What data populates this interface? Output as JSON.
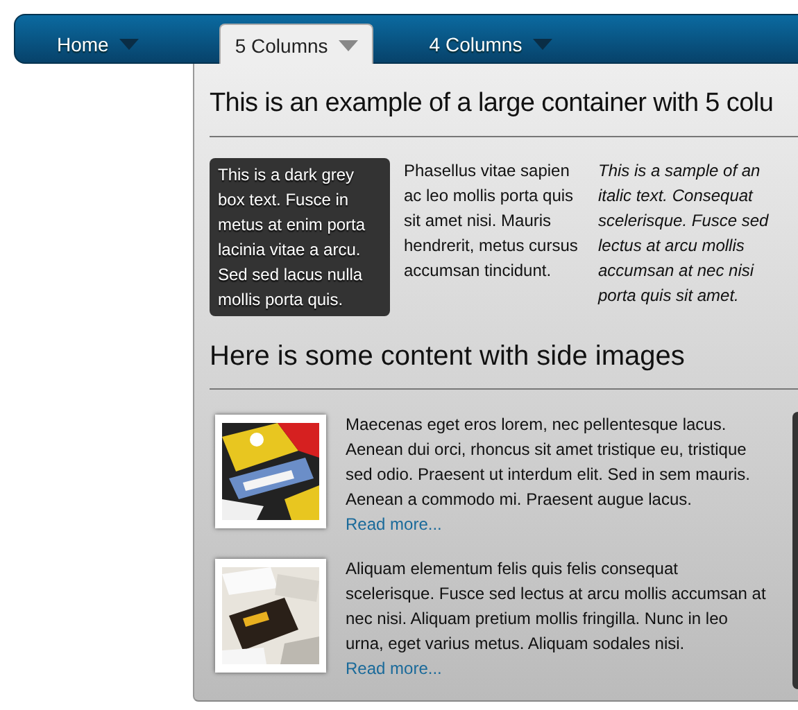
{
  "nav": {
    "items": [
      {
        "label": "Home",
        "selected": false
      },
      {
        "label": "5 Columns",
        "selected": true
      },
      {
        "label": "4 Columns",
        "selected": false
      }
    ]
  },
  "panel": {
    "heading": "This is an example of a large container with 5 colu",
    "columns": [
      {
        "kind": "dark",
        "text": "This is a dark grey box text. Fusce in metus at enim porta lacinia vitae a arcu. Sed sed lacus nulla mollis porta quis."
      },
      {
        "kind": "plain",
        "text": "Phasellus vitae sapien ac leo mollis porta quis sit amet nisi. Mauris hendrerit, metus cursus accumsan tincidunt."
      },
      {
        "kind": "italic",
        "text": "This is a sample of an italic text. Consequat scelerisque. Fusce sed lectus at arcu mollis accumsan at nec nisi porta quis sit amet."
      }
    ],
    "section_heading": "Here is some content with side images",
    "articles": [
      {
        "text": "Maecenas eget eros lorem, nec pellentesque lacus. Aenean dui orci, rhoncus sit amet tristique eu, tristique sed odio. Praesent ut interdum elit. Sed in sem mauris. Aenean a commodo mi. Praesent augue lacus.",
        "link": "Read more..."
      },
      {
        "text": "Aliquam elementum felis quis felis consequat scelerisque. Fusce sed lectus at arcu mollis accumsan at nec nisi. Aliquam pretium mollis fringilla. Nunc in leo urna, eget varius metus. Aliquam sodales nisi.",
        "link": "Read more..."
      }
    ]
  }
}
